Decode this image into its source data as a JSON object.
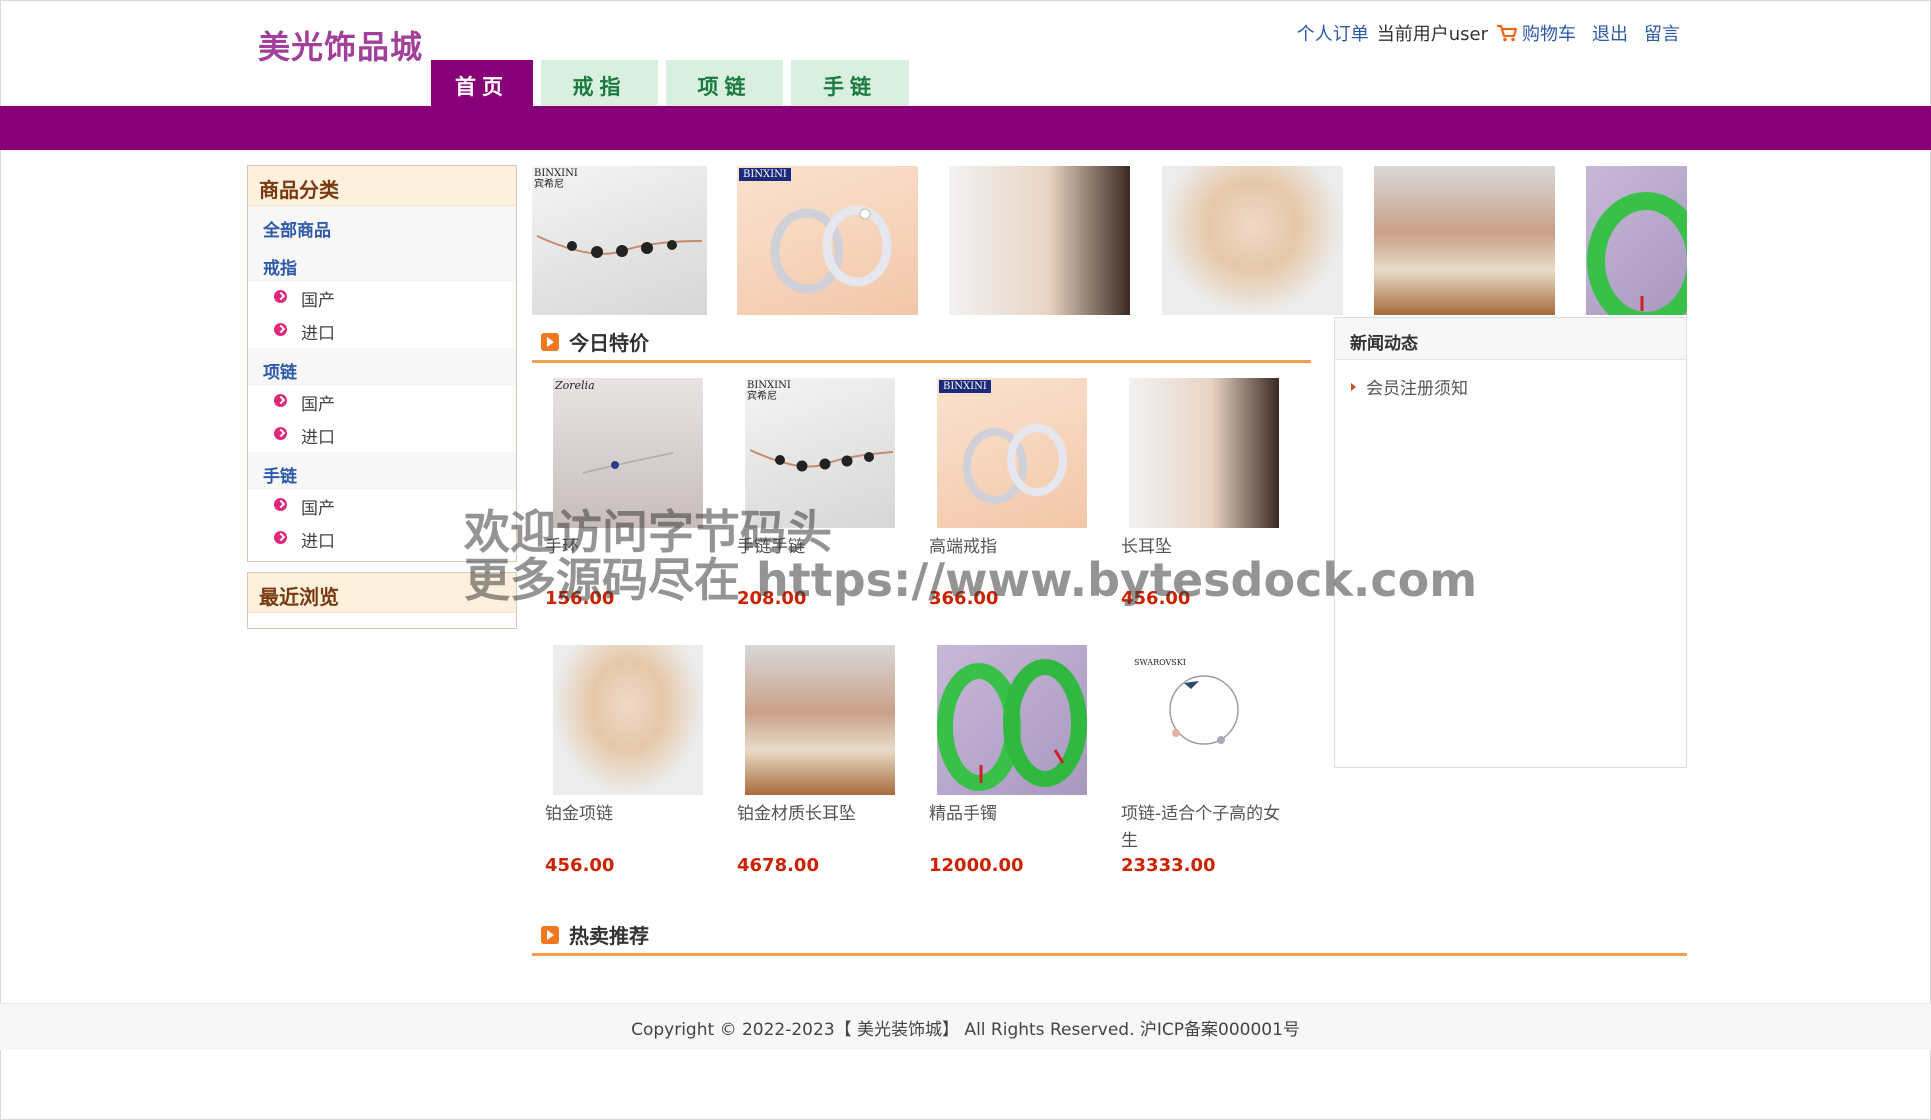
{
  "header": {
    "logo": "美光饰品城",
    "links": {
      "orders": "个人订单",
      "current_user": "当前用户user",
      "cart": "购物车",
      "logout": "退出",
      "message": "留言"
    }
  },
  "nav": {
    "tabs": [
      {
        "label": "首页",
        "active": true
      },
      {
        "label": "戒指",
        "active": false
      },
      {
        "label": "项链",
        "active": false
      },
      {
        "label": "手链",
        "active": false
      }
    ]
  },
  "sidebar": {
    "category_title": "商品分类",
    "all_products": "全部商品",
    "groups": [
      {
        "label": "戒指",
        "subs": [
          "国产",
          "进口"
        ]
      },
      {
        "label": "项链",
        "subs": [
          "国产",
          "进口"
        ]
      },
      {
        "label": "手链",
        "subs": [
          "国产",
          "进口"
        ]
      }
    ],
    "recent_title": "最近浏览"
  },
  "sections": {
    "daily_special": "今日特价",
    "hot_sale": "热卖推荐"
  },
  "products": [
    {
      "name": "手环",
      "price": "156.00"
    },
    {
      "name": "手链手链",
      "price": "208.00"
    },
    {
      "name": "高端戒指",
      "price": "366.00"
    },
    {
      "name": "长耳坠",
      "price": "456.00"
    },
    {
      "name": "铂金项链",
      "price": "456.00"
    },
    {
      "name": "铂金材质长耳坠",
      "price": "4678.00"
    },
    {
      "name": "精品手镯",
      "price": "12000.00"
    },
    {
      "name": "项链-适合个子高的女生",
      "price": "23333.00"
    }
  ],
  "brand_tags": {
    "binxini": "BINXINI",
    "binxini_cn": "宾希尼",
    "swarovski": "SWAROVSKI",
    "zorelia": "Zorelia"
  },
  "news": {
    "title": "新闻动态",
    "items": [
      "会员注册须知"
    ]
  },
  "watermark": {
    "line1": "欢迎访问字节码头",
    "line2": "更多源码尽在 https://www.bytesdock.com"
  },
  "footer": {
    "copyright": "Copyright © 2022-2023【 美光装饰城】 All Rights Reserved. 沪ICP备案000001号"
  },
  "colors": {
    "brand_purple": "#880077",
    "logo": "#a0409a",
    "tab_bg": "#d9f0e0",
    "tab_text": "#1c7a3e",
    "price": "#cc2200",
    "link": "#2d5aa8",
    "section_line": "#f2a050"
  }
}
